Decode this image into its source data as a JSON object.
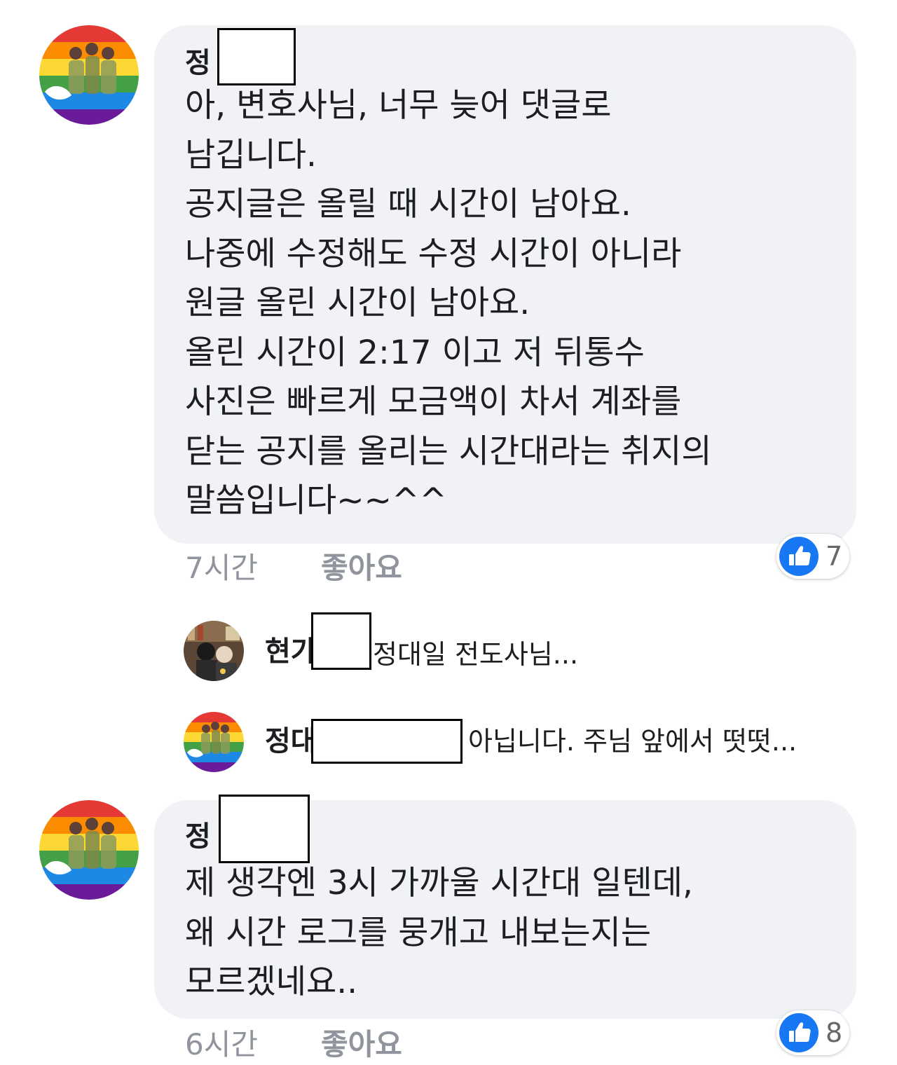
{
  "comments": [
    {
      "author": "정",
      "text": "아, 변호사님, 너무 늦어 댓글로\n남깁니다.\n공지글은 올릴 때 시간이 남아요.\n나중에 수정해도 수정 시간이 아니라\n원글 올린 시간이 남아요.\n올린 시간이 2:17 이고 저 뒤통수\n사진은 빠르게 모금액이 차서 계좌를\n닫는 공지를 올리는 시간대라는 취지의\n말씀입니다~~^^",
      "time": "7시간",
      "like_label": "좋아요",
      "reaction_count": "7"
    },
    {
      "author": "정",
      "text": "제 생각엔 3시 가까울 시간대 일텐데,\n왜 시간 로그를 뭉개고 내보는지는\n모르겠네요..",
      "time": "6시간",
      "like_label": "좋아요",
      "reaction_count": "8"
    }
  ],
  "replies": [
    {
      "author": "현가",
      "text": "정대일 전도사님..."
    },
    {
      "author": "정대",
      "text": "아닙니다. 주님 앞에서 떳떳..."
    }
  ],
  "icons": {
    "avatar_rainbow": "rainbow-family-avatar",
    "avatar_photo": "photo-avatar",
    "like": "thumbs-up-icon"
  },
  "colors": {
    "bubble": "#f0f2f5",
    "like_blue": "#1877f2",
    "meta_gray": "#90949c"
  }
}
